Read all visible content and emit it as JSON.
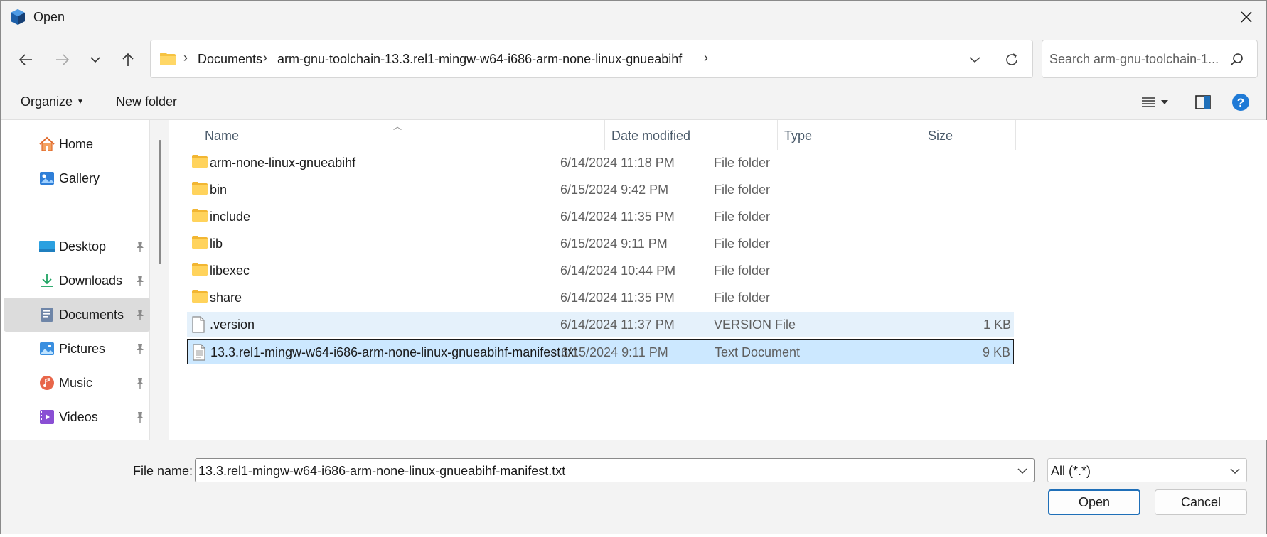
{
  "window": {
    "title": "Open"
  },
  "address": {
    "crumbs": [
      "Documents",
      "arm-gnu-toolchain-13.3.rel1-mingw-w64-i686-arm-none-linux-gnueabihf"
    ],
    "separator": "›"
  },
  "search": {
    "placeholder": "Search arm-gnu-toolchain-1..."
  },
  "toolbar": {
    "organize": "Organize",
    "new_folder": "New folder",
    "help": "?"
  },
  "sidebar": {
    "items": [
      {
        "label": "Home",
        "icon": "home-icon"
      },
      {
        "label": "Gallery",
        "icon": "gallery-icon"
      },
      {
        "label": "Desktop",
        "icon": "desktop-icon",
        "pinned": true
      },
      {
        "label": "Downloads",
        "icon": "downloads-icon",
        "pinned": true
      },
      {
        "label": "Documents",
        "icon": "documents-icon",
        "pinned": true,
        "selected": true
      },
      {
        "label": "Pictures",
        "icon": "pictures-icon",
        "pinned": true
      },
      {
        "label": "Music",
        "icon": "music-icon",
        "pinned": true
      },
      {
        "label": "Videos",
        "icon": "videos-icon",
        "pinned": true
      }
    ]
  },
  "columns": {
    "name": "Name",
    "date": "Date modified",
    "type": "Type",
    "size": "Size"
  },
  "files": [
    {
      "name": "arm-none-linux-gnueabihf",
      "date": "6/14/2024 11:18 PM",
      "type": "File folder",
      "size": "",
      "kind": "folder"
    },
    {
      "name": "bin",
      "date": "6/15/2024 9:42 PM",
      "type": "File folder",
      "size": "",
      "kind": "folder"
    },
    {
      "name": "include",
      "date": "6/14/2024 11:35 PM",
      "type": "File folder",
      "size": "",
      "kind": "folder"
    },
    {
      "name": "lib",
      "date": "6/15/2024 9:11 PM",
      "type": "File folder",
      "size": "",
      "kind": "folder"
    },
    {
      "name": "libexec",
      "date": "6/14/2024 10:44 PM",
      "type": "File folder",
      "size": "",
      "kind": "folder"
    },
    {
      "name": "share",
      "date": "6/14/2024 11:35 PM",
      "type": "File folder",
      "size": "",
      "kind": "folder"
    },
    {
      "name": ".version",
      "date": "6/14/2024 11:37 PM",
      "type": "VERSION File",
      "size": "1 KB",
      "kind": "file"
    },
    {
      "name": "13.3.rel1-mingw-w64-i686-arm-none-linux-gnueabihf-manifest.txt",
      "date": "6/15/2024 9:11 PM",
      "type": "Text Document",
      "size": "9 KB",
      "kind": "text"
    }
  ],
  "footer": {
    "file_name_label": "File name:",
    "file_name_value": "13.3.rel1-mingw-w64-i686-arm-none-linux-gnueabihf-manifest.txt",
    "filter_value": "All (*.*)",
    "open_label": "Open",
    "cancel_label": "Cancel"
  },
  "colors": {
    "accent": "#1f6fb8",
    "selection": "#cce8ff",
    "hover": "#e5f1fb",
    "folder": "#f6c342"
  }
}
